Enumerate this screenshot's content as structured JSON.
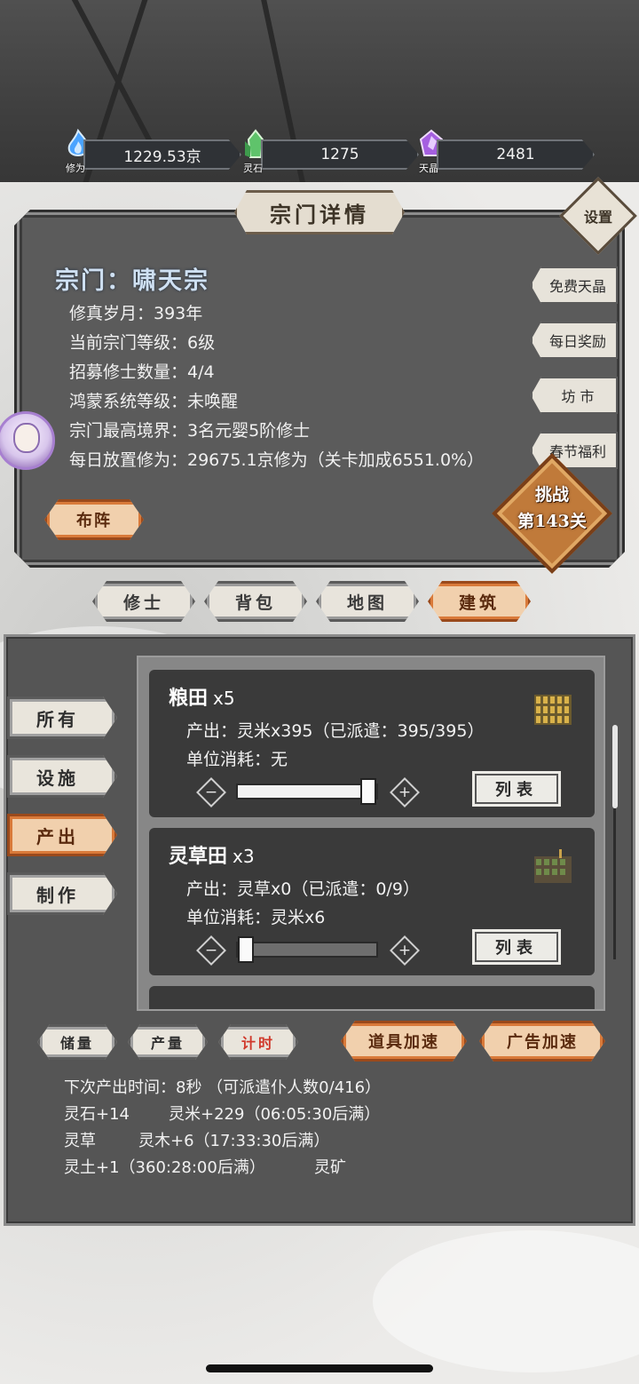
{
  "resources": [
    {
      "icon": "cultivation-flame-icon",
      "caption": "修为",
      "value": "1229.53京",
      "color": "#6fb4ff"
    },
    {
      "icon": "spirit-stone-crystal-icon",
      "caption": "灵石",
      "value": "1275",
      "color": "#5fc36b"
    },
    {
      "icon": "heaven-crystal-icon",
      "caption": "天晶",
      "value": "2481",
      "color": "#a55fe0"
    }
  ],
  "sect_panel": {
    "title": "宗门详情",
    "settings_label": "设置",
    "sect_name": "宗门：啸天宗",
    "info": [
      "修真岁月：393年",
      "当前宗门等级：6级",
      "招募修士数量：4/4",
      "鸿蒙系统等级：未唤醒",
      "宗门最高境界：3名元婴5阶修士",
      "每日放置修为：29675.1京修为（关卡加成6551.0%）"
    ],
    "side_buttons": [
      "免费天晶",
      "每日奖励",
      "坊 市",
      "春节福利"
    ],
    "formation_button": "布阵",
    "challenge_line1": "挑战",
    "challenge_line2": "第143关"
  },
  "main_tabs": [
    {
      "label": "修士",
      "active": false
    },
    {
      "label": "背包",
      "active": false
    },
    {
      "label": "地图",
      "active": false
    },
    {
      "label": "建筑",
      "active": true
    }
  ],
  "categories": [
    {
      "label": "所有",
      "active": false
    },
    {
      "label": "设施",
      "active": false
    },
    {
      "label": "产出",
      "active": true
    },
    {
      "label": "制作",
      "active": false
    }
  ],
  "buildings": [
    {
      "name": "粮田",
      "count": "x5",
      "output": "产出：灵米x395（已派遣：395/395）",
      "consumption": "单位消耗：无",
      "slider_fraction": 1.0,
      "list_label": "列表",
      "thumb_icon": "rice-field-icon"
    },
    {
      "name": "灵草田",
      "count": "x3",
      "output": "产出：灵草x0（已派遣：0/9）",
      "consumption": "单位消耗：灵米x6",
      "slider_fraction": 0.0,
      "list_label": "列表",
      "thumb_icon": "herb-field-icon"
    }
  ],
  "bottom_tabs": [
    {
      "label": "储量",
      "active": false
    },
    {
      "label": "产量",
      "active": false
    },
    {
      "label": "计时",
      "active": true
    }
  ],
  "speed_buttons": [
    "道具加速",
    "广告加速"
  ],
  "production_info": {
    "next_time": "下次产出时间：8秒 （可派遣仆人数0/416）",
    "r1a": "灵石+14",
    "r1b": "灵米+229（06:05:30后满）",
    "r2a": "灵草",
    "r2b": "灵木+6（17:33:30后满）",
    "r3a": "灵土+1（360:28:00后满）",
    "r3b": "灵矿"
  }
}
